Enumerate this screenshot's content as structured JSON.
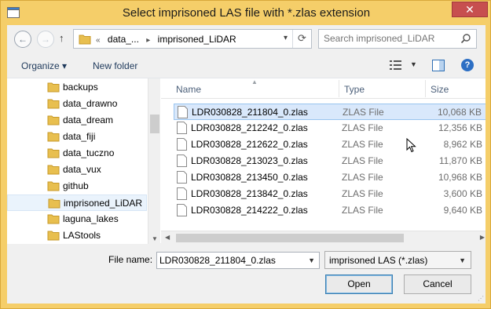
{
  "window": {
    "title": "Select imprisoned LAS file with *.zlas extension",
    "close_label": "✕"
  },
  "nav": {
    "back_label": "←",
    "forward_label": "→",
    "up_label": "↑",
    "crumb_overflow": "«",
    "crumbs": [
      "data_...",
      "imprisoned_LiDAR"
    ],
    "search_placeholder": "Search imprisoned_LiDAR"
  },
  "commands": {
    "organize": "Organize ▾",
    "new_folder": "New folder",
    "help_label": "?"
  },
  "tree": {
    "items": [
      {
        "label": "backups",
        "selected": false
      },
      {
        "label": "data_drawno",
        "selected": false
      },
      {
        "label": "data_dream",
        "selected": false
      },
      {
        "label": "data_fiji",
        "selected": false
      },
      {
        "label": "data_tuczno",
        "selected": false
      },
      {
        "label": "data_vux",
        "selected": false
      },
      {
        "label": "github",
        "selected": false
      },
      {
        "label": "imprisoned_LiDAR",
        "selected": true
      },
      {
        "label": "laguna_lakes",
        "selected": false
      },
      {
        "label": "LAStools",
        "selected": false
      }
    ]
  },
  "list": {
    "columns": {
      "name": "Name",
      "type": "Type",
      "size": "Size"
    },
    "rows": [
      {
        "name": "LDR030828_211804_0.zlas",
        "type": "ZLAS File",
        "size": "10,068 KB",
        "selected": true
      },
      {
        "name": "LDR030828_212242_0.zlas",
        "type": "ZLAS File",
        "size": "12,356 KB",
        "selected": false
      },
      {
        "name": "LDR030828_212622_0.zlas",
        "type": "ZLAS File",
        "size": "8,962 KB",
        "selected": false
      },
      {
        "name": "LDR030828_213023_0.zlas",
        "type": "ZLAS File",
        "size": "11,870 KB",
        "selected": false
      },
      {
        "name": "LDR030828_213450_0.zlas",
        "type": "ZLAS File",
        "size": "10,968 KB",
        "selected": false
      },
      {
        "name": "LDR030828_213842_0.zlas",
        "type": "ZLAS File",
        "size": "3,600 KB",
        "selected": false
      },
      {
        "name": "LDR030828_214222_0.zlas",
        "type": "ZLAS File",
        "size": "9,640 KB",
        "selected": false
      }
    ]
  },
  "footer": {
    "file_name_label": "File name:",
    "file_name_value": "LDR030828_211804_0.zlas",
    "filter_value": "imprisoned LAS (*.zlas)",
    "open_label": "Open",
    "cancel_label": "Cancel"
  },
  "colors": {
    "frame": "#f5ce69",
    "close": "#c74f4f",
    "selection": "#d9e8fb",
    "folder": "#e8bf4f"
  }
}
